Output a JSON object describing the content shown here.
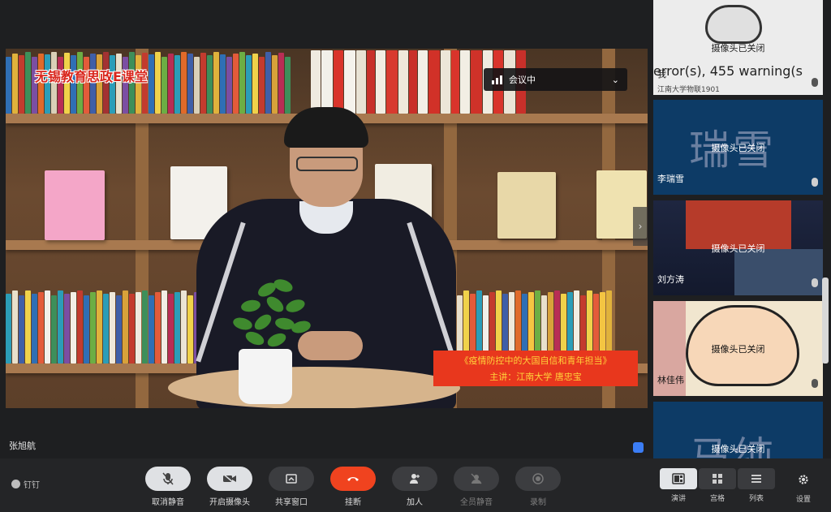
{
  "main_video": {
    "logo_text": "无锡教育思政E课堂",
    "banner_line1": "《疫情防控中的大国自信和青年担当》",
    "banner_line2": "主讲：江南大学  唐忠宝",
    "speaker_name": "张旭航",
    "meeting_status": "会议中"
  },
  "participants": [
    {
      "name": "我",
      "subtitle": "江南大学物联1901",
      "status": "摄像头已关闭",
      "background_text": "error(s), 455 warning(s"
    },
    {
      "name": "李瑞雪",
      "status": "摄像头已关闭",
      "avatar_text": "瑞雪"
    },
    {
      "name": "刘方涛",
      "status": "摄像头已关闭"
    },
    {
      "name": "林佳伟",
      "status": "摄像头已关闭"
    },
    {
      "name": "",
      "status": "摄像头已关闭",
      "avatar_text": "马纯"
    }
  ],
  "toolbar": {
    "pin_label": "钉钉",
    "unmute_label": "取消静音",
    "camera_label": "开启摄像头",
    "share_label": "共享窗口",
    "hangup_label": "挂断",
    "join_label": "加人",
    "mute_all_label": "全员静音",
    "record_label": "录制"
  },
  "views": {
    "speaker_label": "演讲",
    "grid_label": "宫格",
    "list_label": "列表",
    "settings_label": "设置"
  },
  "colors": {
    "hangup": "#f0431f",
    "banner": "#e8371d",
    "tile_blue": "#0d3b66"
  }
}
